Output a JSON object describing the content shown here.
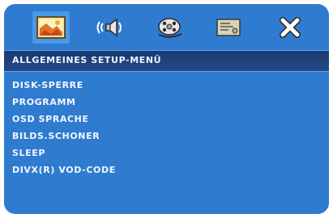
{
  "toolbar": {
    "tabs": [
      {
        "icon": "general-setup-icon"
      },
      {
        "icon": "audio-speaker-icon"
      },
      {
        "icon": "video-reel-icon"
      },
      {
        "icon": "preferences-panel-icon"
      },
      {
        "icon": "close-icon"
      }
    ]
  },
  "header": {
    "title": "ALLGEMEINES SETUP-MENÜ"
  },
  "menu": {
    "items": [
      {
        "label": "DISK-SPERRE"
      },
      {
        "label": "PROGRAMM"
      },
      {
        "label": "OSD SPRACHE"
      },
      {
        "label": "BILDS.SCHONER"
      },
      {
        "label": "SLEEP"
      },
      {
        "label": "DIVX(R) VOD-CODE"
      }
    ]
  },
  "colors": {
    "background": "#2e79cf",
    "active_tab": "#4a98e8",
    "header_bar": "#1f437c",
    "text": "#f2f7ff"
  }
}
